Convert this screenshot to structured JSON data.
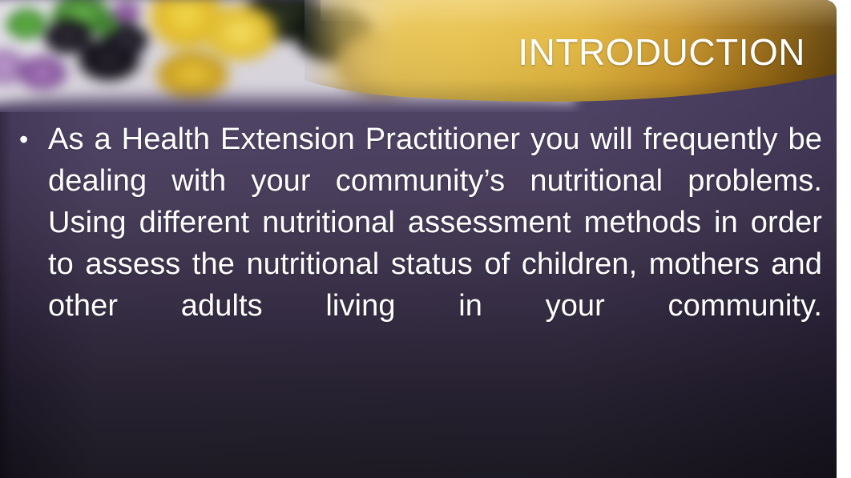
{
  "slide": {
    "title": "INTRODUCTION",
    "bullet_marker": "•",
    "body_text": "As a Health Extension Practitioner you will frequently be dealing with your community’s nutritional problems. Using different nutritional assessment methods in order to assess the nutritional status of children, mothers and other adults living in your community.",
    "body_lines": [
      "As a Health Extension Practitioner you will",
      "frequently be dealing with your community’s",
      "nutritional problems. Using different nutritional",
      "assessment methods in order to assess the",
      "nutritional status of children, mothers and other",
      "adults living in your community."
    ]
  },
  "theme": {
    "title_color": "#ffffff",
    "body_text_color": "#ffffff",
    "banner_gold_light": "#e8c24e",
    "banner_gold_mid": "#d9a932",
    "banner_gold_dark": "#6b4a0a",
    "background_top": "#4b3f63",
    "background_bottom": "#15121c",
    "page_margin_color": "#ffffff"
  },
  "decor": {
    "header_photo": "fruit-photo",
    "header_photo_subjects": [
      "green-grapes",
      "purple-grapes",
      "dark-grapes",
      "yellow-pears",
      "lemons"
    ]
  }
}
